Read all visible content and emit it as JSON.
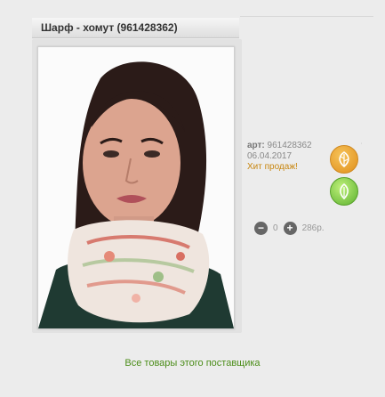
{
  "product": {
    "title": "Шарф - хомут (961428362)",
    "article_label": "арт:",
    "article_value": "961428362",
    "date": "06.04.2017",
    "sales_label": "Хит продаж!"
  },
  "actions": {
    "favorite_icon": "leaf-favorite-icon",
    "basket_icon": "leaf-add-icon",
    "orange_color": "#f0a830",
    "green_color": "#7fd040"
  },
  "quantity": {
    "minus": "−",
    "value": "0",
    "plus": "+",
    "price": "286р."
  },
  "footer": {
    "supplier_link": "Все товары этого поставщика"
  }
}
